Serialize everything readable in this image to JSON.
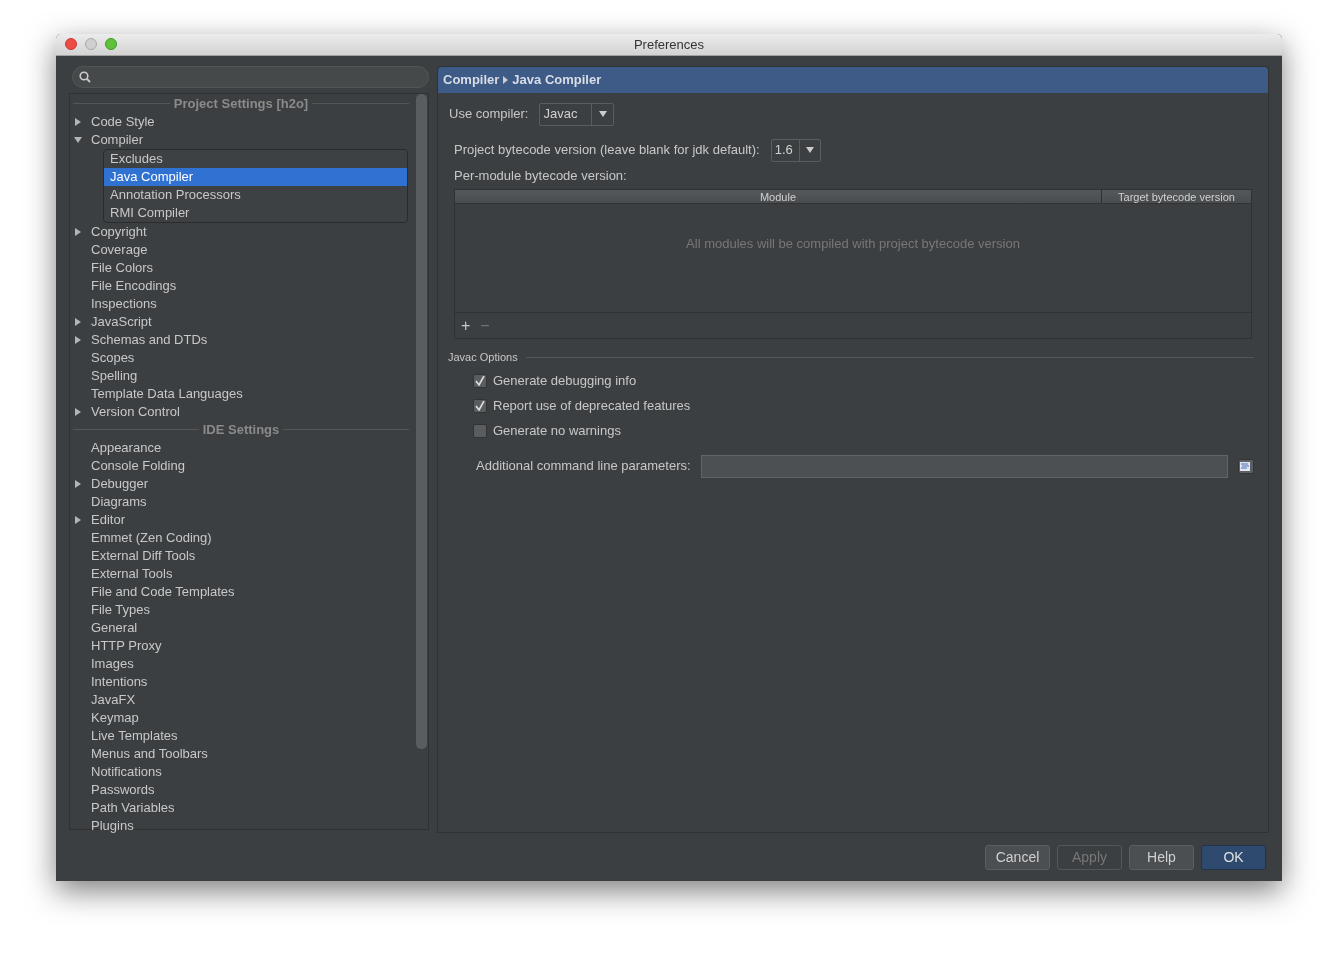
{
  "window": {
    "title": "Preferences"
  },
  "sidebar": {
    "sections": [
      {
        "title": "Project Settings [h2o]",
        "items": [
          {
            "label": "Code Style",
            "expanded": false,
            "selected": false
          },
          {
            "label": "Compiler",
            "expanded": true,
            "selected": false,
            "children": [
              {
                "label": "Excludes",
                "selected": false
              },
              {
                "label": "Java Compiler",
                "selected": true
              },
              {
                "label": "Annotation Processors",
                "selected": false
              },
              {
                "label": "RMI Compiler",
                "selected": false
              }
            ]
          },
          {
            "label": "Copyright",
            "expanded": false,
            "selected": false
          },
          {
            "label": "Coverage",
            "selected": false
          },
          {
            "label": "File Colors",
            "selected": false
          },
          {
            "label": "File Encodings",
            "selected": false
          },
          {
            "label": "Inspections",
            "selected": false
          },
          {
            "label": "JavaScript",
            "expanded": false,
            "selected": false
          },
          {
            "label": "Schemas and DTDs",
            "expanded": false,
            "selected": false
          },
          {
            "label": "Scopes",
            "selected": false
          },
          {
            "label": "Spelling",
            "selected": false
          },
          {
            "label": "Template Data Languages",
            "selected": false
          },
          {
            "label": "Version Control",
            "expanded": false,
            "selected": false
          }
        ]
      },
      {
        "title": "IDE Settings",
        "items": [
          {
            "label": "Appearance",
            "selected": false
          },
          {
            "label": "Console Folding",
            "selected": false
          },
          {
            "label": "Debugger",
            "expanded": false,
            "selected": false
          },
          {
            "label": "Diagrams",
            "selected": false
          },
          {
            "label": "Editor",
            "expanded": false,
            "selected": false
          },
          {
            "label": "Emmet (Zen Coding)",
            "selected": false
          },
          {
            "label": "External Diff Tools",
            "selected": false
          },
          {
            "label": "External Tools",
            "selected": false
          },
          {
            "label": "File and Code Templates",
            "selected": false
          },
          {
            "label": "File Types",
            "selected": false
          },
          {
            "label": "General",
            "selected": false
          },
          {
            "label": "HTTP Proxy",
            "selected": false
          },
          {
            "label": "Images",
            "selected": false
          },
          {
            "label": "Intentions",
            "selected": false
          },
          {
            "label": "JavaFX",
            "selected": false
          },
          {
            "label": "Keymap",
            "selected": false
          },
          {
            "label": "Live Templates",
            "selected": false
          },
          {
            "label": "Menus and Toolbars",
            "selected": false
          },
          {
            "label": "Notifications",
            "selected": false
          },
          {
            "label": "Passwords",
            "selected": false
          },
          {
            "label": "Path Variables",
            "selected": false
          },
          {
            "label": "Plugins",
            "selected": false
          }
        ]
      }
    ]
  },
  "panel": {
    "breadcrumb": [
      "Compiler",
      "Java Compiler"
    ],
    "use_compiler": {
      "label": "Use compiler:",
      "value": "Javac"
    },
    "bytecode": {
      "label": "Project bytecode version (leave blank for jdk default):",
      "value": "1.6"
    },
    "per_module": {
      "label": "Per-module bytecode version:",
      "columns": [
        "Module",
        "Target bytecode version"
      ],
      "empty_text": "All modules will be compiled with project bytecode version",
      "add": "+",
      "remove": "−"
    },
    "javac_options": {
      "title": "Javac Options",
      "checkboxes": [
        {
          "label": "Generate debugging info",
          "checked": true
        },
        {
          "label": "Report use of deprecated features",
          "checked": true
        },
        {
          "label": "Generate no warnings",
          "checked": false
        }
      ],
      "params": {
        "label": "Additional command line parameters:"
      }
    }
  },
  "buttons": [
    {
      "label": "Cancel",
      "disabled": false,
      "default": false
    },
    {
      "label": "Apply",
      "disabled": true,
      "default": false
    },
    {
      "label": "Help",
      "disabled": false,
      "default": false
    },
    {
      "label": "OK",
      "disabled": false,
      "default": true
    }
  ]
}
